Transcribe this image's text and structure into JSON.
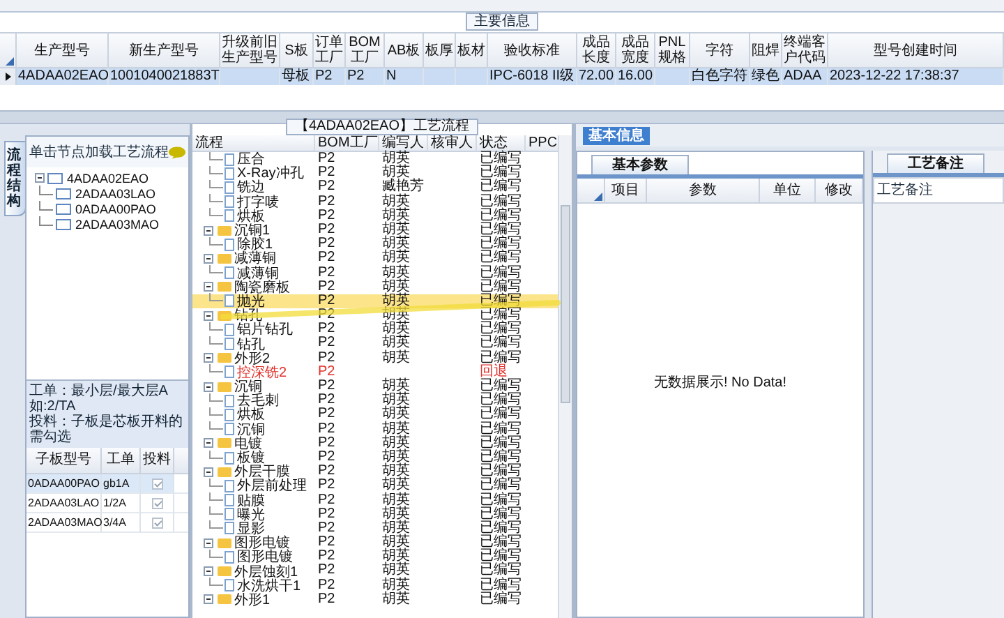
{
  "main_info": {
    "title": "主要信息",
    "columns": [
      "生产型号",
      "新生产型号",
      "升级前旧生产型号",
      "S板",
      "订单工厂",
      "BOM工厂",
      "AB板",
      "板厚",
      "板材",
      "验收标准",
      "成品长度",
      "成品宽度",
      "PNL规格",
      "字符",
      "阻焊",
      "终端客户代码",
      "型号创建时间"
    ],
    "rows": [
      {
        "selected": true,
        "cells": [
          "4ADAA02EAO",
          "1001040021883T",
          "",
          "母板",
          "P2",
          "P2",
          "N",
          "",
          "",
          "IPC-6018 II级",
          "72.00",
          "16.00",
          "",
          "白色字符",
          "绿色",
          "ADAA",
          "2023-12-22 17:38:37"
        ]
      }
    ]
  },
  "left_panel": {
    "side_tab": "流程结构",
    "hint": "单击节点加载工艺流程",
    "tree": [
      {
        "label": "4ADAA02EAO",
        "expanded": true,
        "children": [
          {
            "label": "2ADAA03LAO"
          },
          {
            "label": "0ADAA00PAO"
          },
          {
            "label": "2ADAA03MAO"
          }
        ]
      }
    ],
    "notes": [
      "工单：最小层/最大层A 如:2/TA",
      "投料：子板是芯板开料的需勾选"
    ],
    "sub_table": {
      "columns": [
        "子板型号",
        "工单",
        "投料"
      ],
      "rows": [
        {
          "cells": [
            "0ADAA00PAO",
            "gb1A"
          ],
          "checked": true,
          "selected": true
        },
        {
          "cells": [
            "2ADAA03LAO",
            "1/2A"
          ],
          "checked": true,
          "selected": false
        },
        {
          "cells": [
            "2ADAA03MAO",
            "3/4A"
          ],
          "checked": true,
          "selected": false
        }
      ]
    }
  },
  "process_panel": {
    "title": "【4ADAA02EAO】工艺流程",
    "columns": [
      "流程",
      "BOM工厂",
      "编写人",
      "核审人",
      "状态",
      "PPC"
    ],
    "groups": [
      {
        "children": [
          {
            "label": "压合",
            "bom": "P2",
            "editor": "胡英",
            "status": "已编写",
            "selected": false,
            "returned": false
          },
          {
            "label": "X-Ray冲孔",
            "bom": "P2",
            "editor": "胡英",
            "status": "已编写",
            "selected": false,
            "returned": false
          },
          {
            "label": "铣边",
            "bom": "P2",
            "editor": "臧艳芳",
            "status": "已编写",
            "selected": false,
            "returned": false
          },
          {
            "label": "打字唛",
            "bom": "P2",
            "editor": "胡英",
            "status": "已编写",
            "selected": false,
            "returned": false
          },
          {
            "label": "烘板",
            "bom": "P2",
            "editor": "胡英",
            "status": "已编写",
            "selected": false,
            "returned": false
          }
        ]
      },
      {
        "label": "沉铜1",
        "bom": "P2",
        "editor": "胡英",
        "status": "已编写",
        "expanded": true,
        "selected": false,
        "children": [
          {
            "label": "除胶1",
            "bom": "P2",
            "editor": "胡英",
            "status": "已编写",
            "selected": false,
            "returned": false
          }
        ]
      },
      {
        "label": "减薄铜",
        "bom": "P2",
        "editor": "胡英",
        "status": "已编写",
        "expanded": true,
        "selected": false,
        "children": [
          {
            "label": "减薄铜",
            "bom": "P2",
            "editor": "胡英",
            "status": "已编写",
            "selected": false,
            "returned": false
          }
        ]
      },
      {
        "label": "陶瓷磨板",
        "bom": "P2",
        "editor": "胡英",
        "status": "已编写",
        "expanded": true,
        "selected": false,
        "children": [
          {
            "label": "抛光",
            "bom": "P2",
            "editor": "胡英",
            "status": "已编写",
            "selected": true,
            "returned": false
          }
        ]
      },
      {
        "label": "钻孔",
        "bom": "P2",
        "editor": "胡英",
        "status": "已编写",
        "expanded": true,
        "selected": false,
        "children": [
          {
            "label": "铝片钻孔",
            "bom": "P2",
            "editor": "胡英",
            "status": "已编写",
            "selected": false,
            "returned": false
          },
          {
            "label": "钻孔",
            "bom": "P2",
            "editor": "胡英",
            "status": "已编写",
            "selected": false,
            "returned": false
          }
        ]
      },
      {
        "label": "外形2",
        "bom": "P2",
        "editor": "胡英",
        "status": "已编写",
        "expanded": true,
        "selected": false,
        "children": [
          {
            "label": "控深铣2",
            "bom": "P2",
            "status": "回退",
            "selected": false,
            "returned": true
          }
        ]
      },
      {
        "label": "沉铜",
        "bom": "P2",
        "editor": "胡英",
        "status": "已编写",
        "expanded": true,
        "selected": false,
        "children": [
          {
            "label": "去毛刺",
            "bom": "P2",
            "editor": "胡英",
            "status": "已编写",
            "selected": false,
            "returned": false
          },
          {
            "label": "烘板",
            "bom": "P2",
            "editor": "胡英",
            "status": "已编写",
            "selected": false,
            "returned": false
          },
          {
            "label": "沉铜",
            "bom": "P2",
            "editor": "胡英",
            "status": "已编写",
            "selected": false,
            "returned": false
          }
        ]
      },
      {
        "label": "电镀",
        "bom": "P2",
        "editor": "胡英",
        "status": "已编写",
        "expanded": true,
        "selected": false,
        "children": [
          {
            "label": "板镀",
            "bom": "P2",
            "editor": "胡英",
            "status": "已编写",
            "selected": false,
            "returned": false
          }
        ]
      },
      {
        "label": "外层干膜",
        "bom": "P2",
        "editor": "胡英",
        "status": "已编写",
        "expanded": true,
        "selected": false,
        "children": [
          {
            "label": "外层前处理",
            "bom": "P2",
            "editor": "胡英",
            "status": "已编写",
            "selected": false,
            "returned": false
          },
          {
            "label": "贴膜",
            "bom": "P2",
            "editor": "胡英",
            "status": "已编写",
            "selected": false,
            "returned": false
          },
          {
            "label": "曝光",
            "bom": "P2",
            "editor": "胡英",
            "status": "已编写",
            "selected": false,
            "returned": false
          },
          {
            "label": "显影",
            "bom": "P2",
            "editor": "胡英",
            "status": "已编写",
            "selected": false,
            "returned": false
          }
        ]
      },
      {
        "label": "图形电镀",
        "bom": "P2",
        "editor": "胡英",
        "status": "已编写",
        "expanded": true,
        "selected": false,
        "children": [
          {
            "label": "图形电镀",
            "bom": "P2",
            "editor": "胡英",
            "status": "已编写",
            "selected": false,
            "returned": false
          }
        ]
      },
      {
        "label": "外层蚀刻1",
        "bom": "P2",
        "editor": "胡英",
        "status": "已编写",
        "expanded": true,
        "selected": false,
        "children": [
          {
            "label": "水洗烘干1",
            "bom": "P2",
            "editor": "胡英",
            "status": "已编写",
            "selected": false,
            "returned": false
          }
        ]
      },
      {
        "label": "外形1",
        "bom": "P2",
        "editor": "胡英",
        "status": "已编写",
        "expanded": true,
        "selected": false
      }
    ]
  },
  "info_panel": {
    "tab": "基本信息",
    "params_tab": "基本参数",
    "params_columns": [
      "项目",
      "参数",
      "单位",
      "修改"
    ],
    "empty_text": "无数据展示! No Data!",
    "notes_tab": "工艺备注",
    "notes_label": "工艺备注"
  }
}
